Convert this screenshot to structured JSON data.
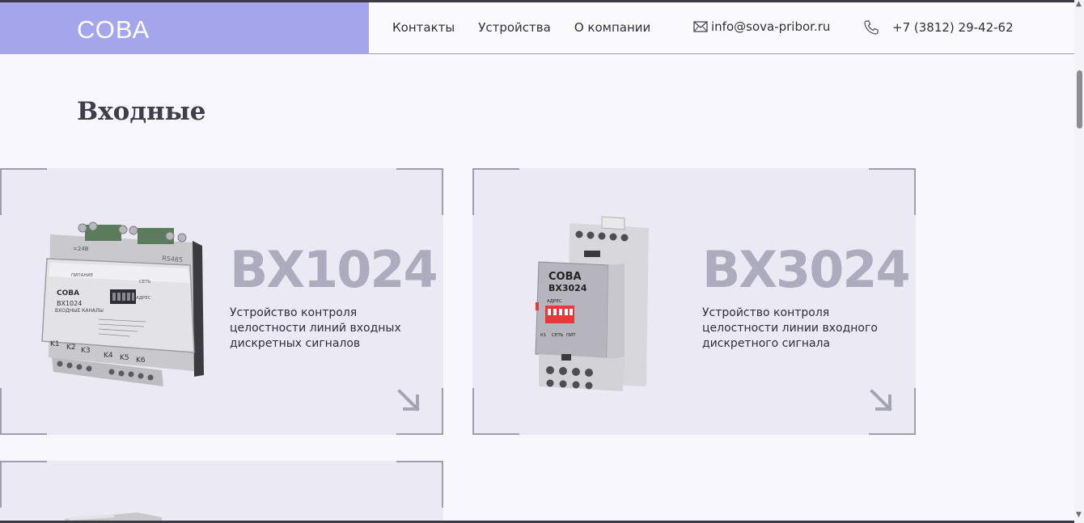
{
  "header": {
    "logo": "СОВА",
    "nav": [
      {
        "label": "Контакты"
      },
      {
        "label": "Устройства"
      },
      {
        "label": "О компании"
      }
    ],
    "email": "info@sova-pribor.ru",
    "phone": "+7 (3812) 29-42-62",
    "icons": {
      "email": "mail-icon",
      "phone": "phone-icon"
    }
  },
  "section": {
    "title": "Входные"
  },
  "cards": [
    {
      "model": "ВХ1024",
      "description": "Устройство контроля целостности линий входных дискретных сигналов",
      "device_label": "СОВА",
      "device_model": "ВХ1024",
      "device_channels": [
        "K1",
        "K2",
        "K3",
        "K4",
        "K5",
        "K6"
      ],
      "device_top_labels": [
        "ПИТАНИЕ",
        "СЕТЬ",
        "АДРЕС",
        "RS485",
        "=24В",
        "ВХОДНЫЕ КАНАЛЫ"
      ]
    },
    {
      "model": "ВХ3024",
      "description": "Устройство контроля целостности линии входного дискретного сигнала",
      "device_label": "СОВА",
      "device_model": "ВХ3024",
      "device_labels": [
        "АДРЕС",
        "К1",
        "СЕТЬ",
        "ПИТ"
      ]
    }
  ],
  "colors": {
    "logo_bg": "#a5a5ec",
    "card_bg": "#ebeaf4",
    "model_text": "#adacbe",
    "page_bg": "#f8f7fd",
    "dip_red": "#e63a3a"
  }
}
